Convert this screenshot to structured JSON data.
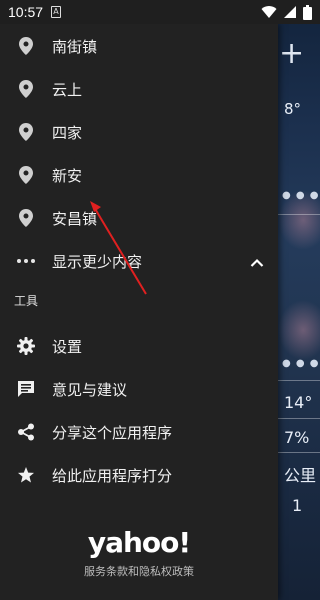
{
  "status_bar": {
    "time": "10:57",
    "notification_icon": "a-box-icon",
    "icons": [
      "wifi-icon",
      "signal-icon",
      "battery-icon"
    ]
  },
  "background": {
    "plus": "+",
    "temp_1": "8°",
    "temp_2": "14°",
    "humidity": "7%",
    "distance": "公里",
    "misc": "1"
  },
  "drawer": {
    "locations": [
      {
        "label": "南街镇",
        "icon": "location-pin-icon"
      },
      {
        "label": "云上",
        "icon": "location-pin-icon"
      },
      {
        "label": "四家",
        "icon": "location-pin-icon"
      },
      {
        "label": "新安",
        "icon": "location-pin-icon"
      },
      {
        "label": "安昌镇",
        "icon": "location-pin-icon"
      }
    ],
    "show_less": {
      "label": "显示更少内容",
      "icon": "more-dots-icon",
      "chevron": "chevron-up-icon"
    },
    "tools_title": "工具",
    "tools": [
      {
        "label": "设置",
        "icon": "gear-icon"
      },
      {
        "label": "意见与建议",
        "icon": "feedback-icon"
      },
      {
        "label": "分享这个应用程序",
        "icon": "share-icon"
      },
      {
        "label": "给此应用程序打分",
        "icon": "star-icon"
      }
    ],
    "footer": {
      "logo": "yahoo!",
      "link": "服务条款和隐私权政策"
    }
  },
  "colors": {
    "drawer_bg": "#222222",
    "annotation": "#e02020"
  }
}
